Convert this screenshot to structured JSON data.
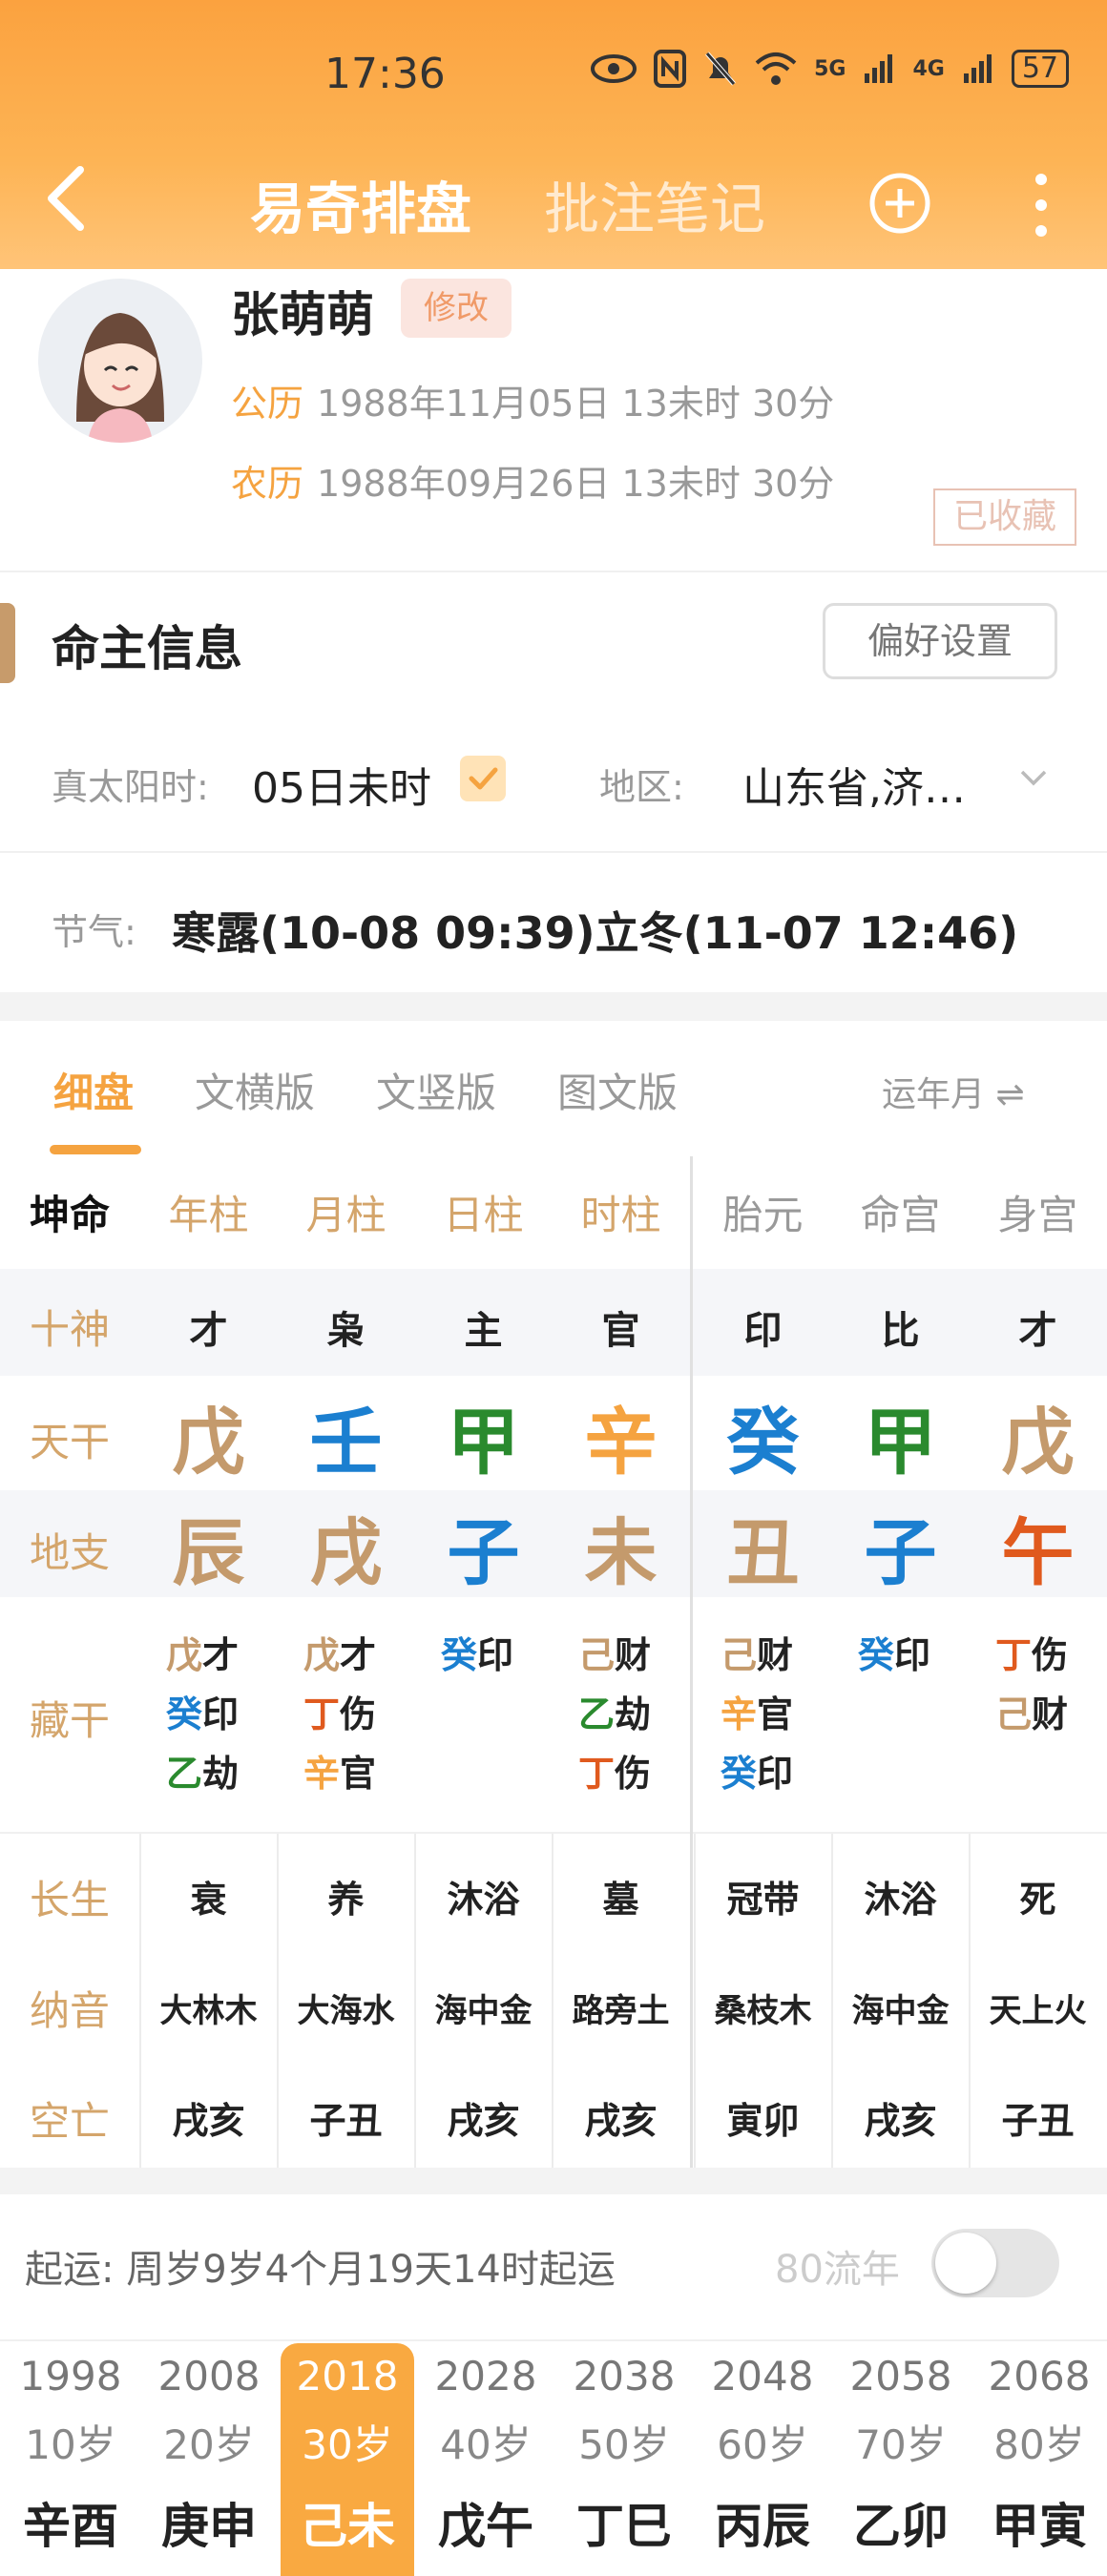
{
  "status": {
    "time": "17:36",
    "battery": "57",
    "net1": "5G",
    "net2": "4G"
  },
  "nav": {
    "title": "易奇排盘",
    "notes": "批注笔记"
  },
  "profile": {
    "name": "张萌萌",
    "edit": "修改",
    "solar_label": "公历",
    "solar": "1988年11月05日 13未时 30分",
    "lunar_label": "农历",
    "lunar": "1988年09月26日 13未时 30分",
    "stamp": "已收藏"
  },
  "info": {
    "title": "命主信息",
    "pref_button": "偏好设置",
    "true_solar_label": "真太阳时:",
    "true_solar_value": "05日未时",
    "region_label": "地区:",
    "region_value": "山东省,济…",
    "jieqi_label": "节气:",
    "jieqi_value": "寒露(10-08 09:39)立冬(11-07 12:46)"
  },
  "tabs": [
    "细盘",
    "文横版",
    "文竖版",
    "图文版"
  ],
  "tab_right": "运年月 ⇌",
  "table": {
    "corner": "坤命",
    "headers": [
      "年柱",
      "月柱",
      "日柱",
      "时柱",
      "胎元",
      "命宫",
      "身宫"
    ],
    "row_labels": {
      "shishen": "十神",
      "tiangan": "天干",
      "dizhi": "地支",
      "canggan": "藏干",
      "changsheng": "长生",
      "nayin": "纳音",
      "kongwang": "空亡"
    },
    "shishen": [
      "才",
      "枭",
      "主",
      "官",
      "印",
      "比",
      "才"
    ],
    "tiangan": [
      {
        "t": "戊",
        "c": "#c49a6c"
      },
      {
        "t": "壬",
        "c": "#1b7fd0"
      },
      {
        "t": "甲",
        "c": "#2a8a2e"
      },
      {
        "t": "辛",
        "c": "#f5a340"
      },
      {
        "t": "癸",
        "c": "#1b7fd0"
      },
      {
        "t": "甲",
        "c": "#2a8a2e"
      },
      {
        "t": "戊",
        "c": "#c49a6c"
      }
    ],
    "dizhi": [
      {
        "t": "辰",
        "c": "#c49a6c"
      },
      {
        "t": "戌",
        "c": "#c49a6c"
      },
      {
        "t": "子",
        "c": "#1b7fd0"
      },
      {
        "t": "未",
        "c": "#c49a6c"
      },
      {
        "t": "丑",
        "c": "#c49a6c"
      },
      {
        "t": "子",
        "c": "#1b7fd0"
      },
      {
        "t": "午",
        "c": "#e05a1e"
      }
    ],
    "canggan": [
      [
        {
          "g": "戊",
          "c": "#c49a6c",
          "s": "才"
        },
        {
          "g": "癸",
          "c": "#1b7fd0",
          "s": "印"
        },
        {
          "g": "乙",
          "c": "#2a8a2e",
          "s": "劫"
        }
      ],
      [
        {
          "g": "戊",
          "c": "#c49a6c",
          "s": "才"
        },
        {
          "g": "丁",
          "c": "#e05a1e",
          "s": "伤"
        },
        {
          "g": "辛",
          "c": "#f5a340",
          "s": "官"
        }
      ],
      [
        {
          "g": "癸",
          "c": "#1b7fd0",
          "s": "印"
        }
      ],
      [
        {
          "g": "己",
          "c": "#c49a6c",
          "s": "财"
        },
        {
          "g": "乙",
          "c": "#2a8a2e",
          "s": "劫"
        },
        {
          "g": "丁",
          "c": "#e05a1e",
          "s": "伤"
        }
      ],
      [
        {
          "g": "己",
          "c": "#c49a6c",
          "s": "财"
        },
        {
          "g": "辛",
          "c": "#f5a340",
          "s": "官"
        },
        {
          "g": "癸",
          "c": "#1b7fd0",
          "s": "印"
        }
      ],
      [
        {
          "g": "癸",
          "c": "#1b7fd0",
          "s": "印"
        }
      ],
      [
        {
          "g": "丁",
          "c": "#e05a1e",
          "s": "伤"
        },
        {
          "g": "己",
          "c": "#c49a6c",
          "s": "财"
        }
      ]
    ],
    "changsheng": [
      "衰",
      "养",
      "沐浴",
      "墓",
      "冠带",
      "沐浴",
      "死"
    ],
    "nayin": [
      "大林木",
      "大海水",
      "海中金",
      "路旁土",
      "桑枝木",
      "海中金",
      "天上火"
    ],
    "kongwang": [
      "戌亥",
      "子丑",
      "戌亥",
      "戌亥",
      "寅卯",
      "戌亥",
      "子丑"
    ]
  },
  "qiyun": {
    "text": "起运:  周岁9岁4个月19天14时起运",
    "liunian": "80流年",
    "toggle_on": false
  },
  "dayun": [
    {
      "year": "1998",
      "age": "10岁",
      "gz": "辛酉",
      "active": false
    },
    {
      "year": "2008",
      "age": "20岁",
      "gz": "庚申",
      "active": false
    },
    {
      "year": "2018",
      "age": "30岁",
      "gz": "己未",
      "active": true
    },
    {
      "year": "2028",
      "age": "40岁",
      "gz": "戊午",
      "active": false
    },
    {
      "year": "2038",
      "age": "50岁",
      "gz": "丁巳",
      "active": false
    },
    {
      "year": "2048",
      "age": "60岁",
      "gz": "丙辰",
      "active": false
    },
    {
      "year": "2058",
      "age": "70岁",
      "gz": "乙卯",
      "active": false
    },
    {
      "year": "2068",
      "age": "80岁",
      "gz": "甲寅",
      "active": false
    }
  ]
}
